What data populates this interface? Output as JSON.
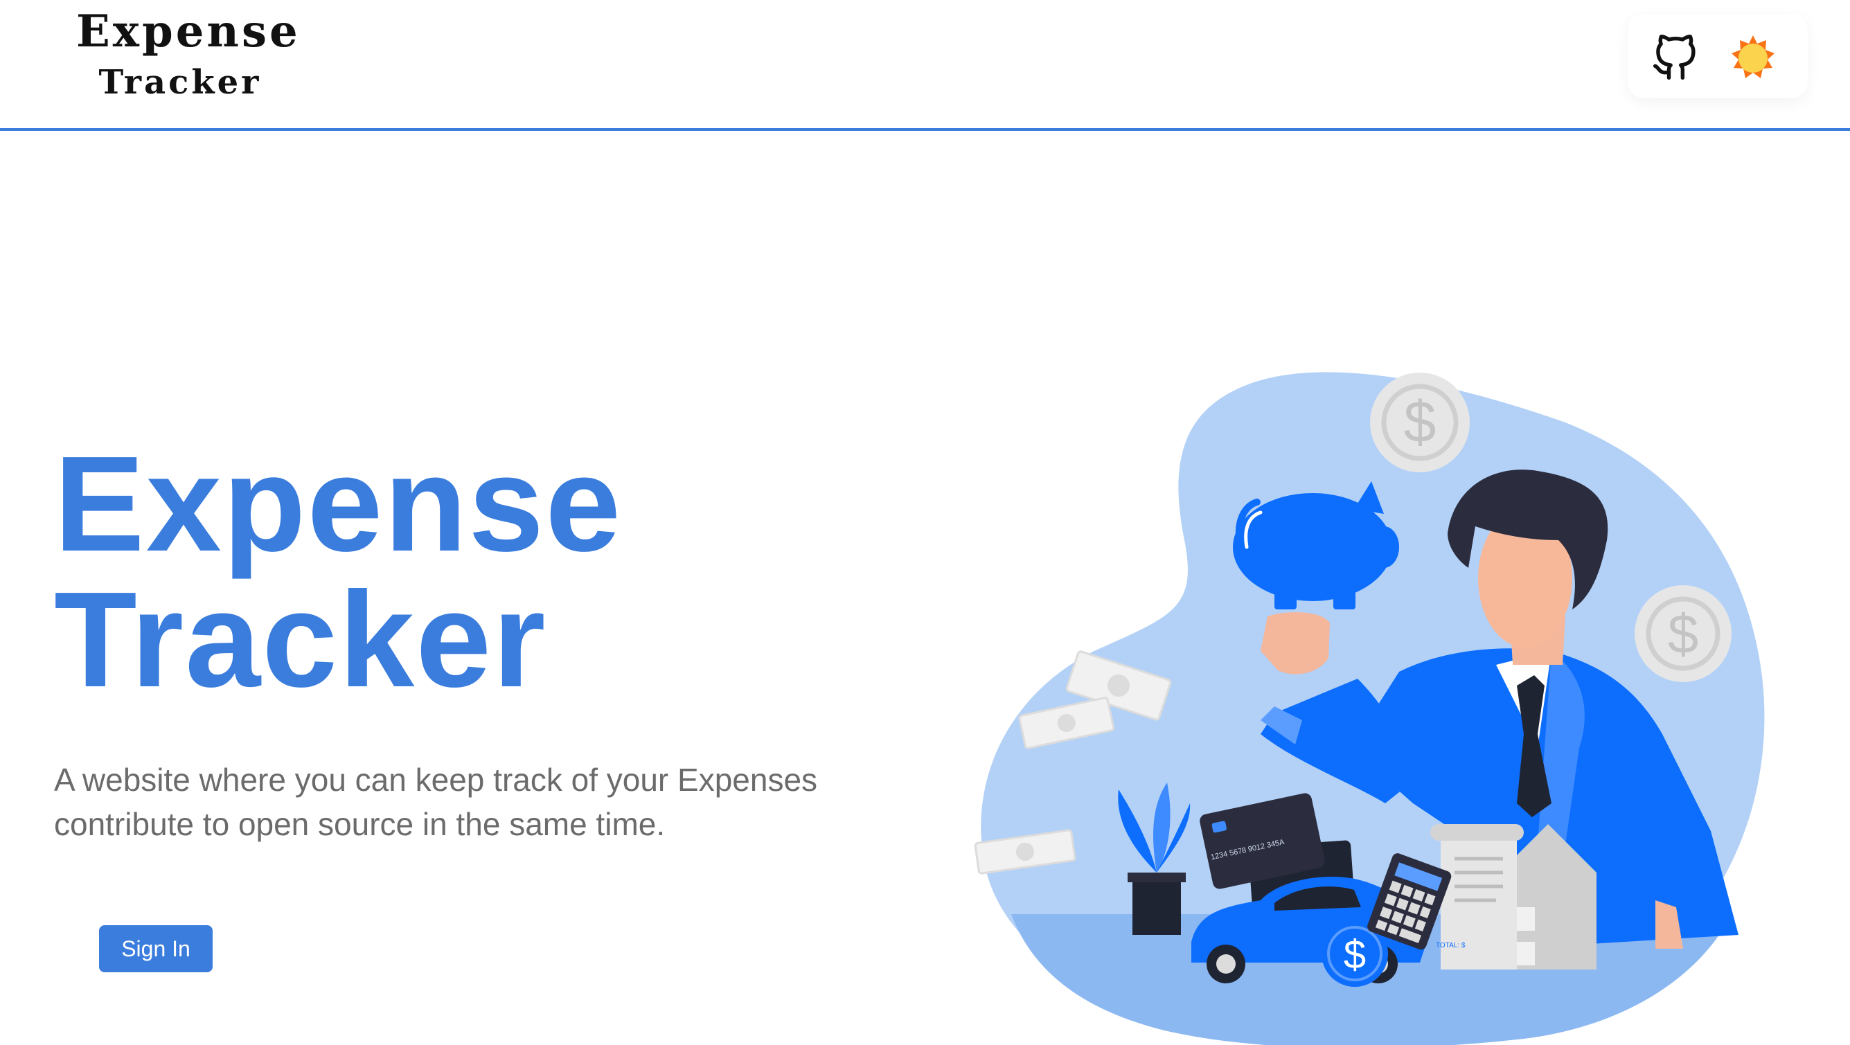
{
  "navbar": {
    "logo_line1": "Expense",
    "logo_line2": "Tracker",
    "icons": {
      "github": "github-icon",
      "theme": "sun-icon"
    }
  },
  "hero": {
    "title_line1": "Expense",
    "title_line2": "Tracker",
    "description_line1": "A website where you can keep track of your Expenses",
    "description_line2": "contribute to open source in the same time.",
    "signin_label": "Sign In"
  },
  "illustration": {
    "card_number": "1234 5678 9012 345A",
    "receipt_total": "TOTAL: $"
  },
  "colors": {
    "accent": "#3b7ddd",
    "illustration_blue": "#0d6efd",
    "illustration_light": "#b3d1f7",
    "sun": "#fbbf24"
  }
}
